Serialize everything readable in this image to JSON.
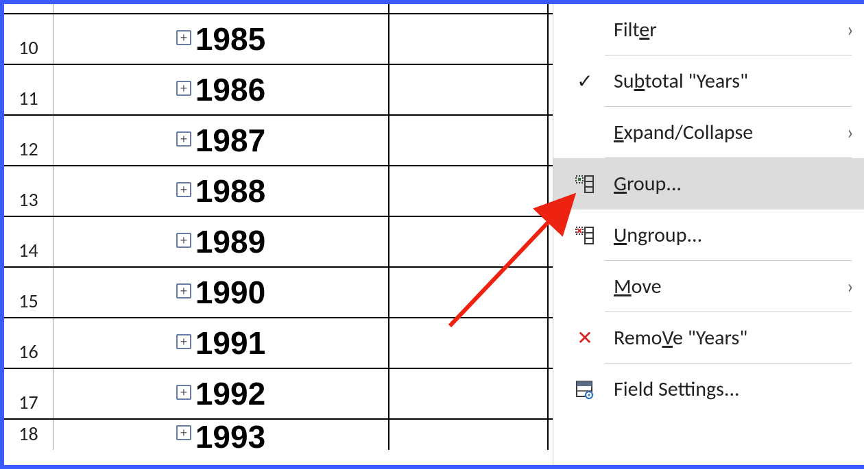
{
  "rows": [
    {
      "num": "10",
      "value": "1985"
    },
    {
      "num": "11",
      "value": "1986"
    },
    {
      "num": "12",
      "value": "1987"
    },
    {
      "num": "13",
      "value": "1988"
    },
    {
      "num": "14",
      "value": "1989"
    },
    {
      "num": "15",
      "value": "1990"
    },
    {
      "num": "16",
      "value": "1991"
    },
    {
      "num": "17",
      "value": "1992"
    },
    {
      "num": "18",
      "value": "1993"
    }
  ],
  "menu": {
    "filter": {
      "label": "Filter",
      "u": "e",
      "pre": "Filt",
      "post": "r",
      "submenu": true,
      "icon": "none"
    },
    "subtotal": {
      "label": "Subtotal \"Years\"",
      "u": "b",
      "pre": "Su",
      "post": "total \"Years\"",
      "submenu": false,
      "icon": "check"
    },
    "expand": {
      "label": "Expand/Collapse",
      "u": "E",
      "pre": "",
      "post": "xpand/Collapse",
      "submenu": true,
      "icon": "none"
    },
    "group": {
      "label": "Group...",
      "u": "G",
      "pre": "",
      "post": "roup...",
      "submenu": false,
      "icon": "group"
    },
    "ungroup": {
      "label": "Ungroup...",
      "u": "U",
      "pre": "",
      "post": "ngroup...",
      "submenu": false,
      "icon": "ungroup"
    },
    "move": {
      "label": "Move",
      "u": "M",
      "pre": "",
      "post": "ove",
      "submenu": true,
      "icon": "none"
    },
    "remove": {
      "label": "Remove \"Years\"",
      "u": "V",
      "pre": "Remo",
      "post": "e \"Years\"",
      "submenu": false,
      "icon": "x"
    },
    "fieldsettings": {
      "label": "Field Settings...",
      "u": "g",
      "pre": "Field Settin",
      "post": "s...",
      "submenu": false,
      "icon": "fieldsettings"
    }
  }
}
